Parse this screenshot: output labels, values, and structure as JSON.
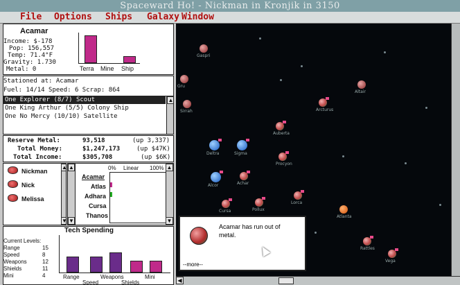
{
  "window": {
    "title": "Spaceward Ho! - Nickman in Kronjik in 3150"
  },
  "menu": [
    "File",
    "Options",
    "Ships",
    "Galaxy",
    "Window"
  ],
  "planet_panel": {
    "name": "Acamar",
    "income": "Income: $-178",
    "pop": "Pop: 156,557",
    "temp": "Temp: 71.4°F",
    "gravity": "Gravity: 1.730",
    "metal": "Metal: 0",
    "bars": [
      {
        "label": "Terra",
        "value": 0.85
      },
      {
        "label": "Mine",
        "value": 0.0
      },
      {
        "label": "Ship",
        "value": 0.22
      }
    ],
    "bar_label_terra": "Terra",
    "bar_label_mine": "Mine",
    "bar_label_ship": "Ship"
  },
  "fleet_panel": {
    "stationed": "Stationed at: Acamar",
    "fuel_speed_scrap": "Fuel: 14/14   Speed: 6    Scrap: 864",
    "ships": [
      "One Explorer (8/7) Scout",
      "One King Arthur (5/5) Colony Ship",
      "One No Mercy (10/10) Satellite"
    ]
  },
  "money_panel": {
    "reserve_label": "Reserve Metal:",
    "reserve_value": "93,518",
    "reserve_change": "(up 3,337)",
    "money_label": "Total Money:",
    "money_value": "$1,247,173",
    "money_change": "(up $47K)",
    "income_label": "Total Income:",
    "income_value": "$305,708",
    "income_change": "(up $6K)"
  },
  "players": [
    "Nickman",
    "Nick",
    "Melissa"
  ],
  "planet_list": {
    "header_pct0": "0%",
    "header_linear": "Linear",
    "header_pct100": "100%",
    "items": [
      "Acamar",
      "Atlas",
      "Adhara",
      "Cursa",
      "Thanos"
    ]
  },
  "tech_panel": {
    "title": "Tech Spending",
    "current_levels": "Current Levels:",
    "levels": [
      {
        "name": "Range",
        "value": "15"
      },
      {
        "name": "Speed",
        "value": "8"
      },
      {
        "name": "Weapons",
        "value": "12"
      },
      {
        "name": "Shields",
        "value": "11"
      },
      {
        "name": "Mini",
        "value": "4"
      }
    ],
    "bar_labels": [
      "Range",
      "Speed",
      "Weapons",
      "Shields",
      "Mini"
    ],
    "bars": [
      0.6,
      0.6,
      0.75,
      0.45,
      0.45
    ]
  },
  "map": {
    "planets": [
      {
        "name": "Gaspri",
        "kind": "red"
      },
      {
        "name": "Gru",
        "kind": "red"
      },
      {
        "name": "Sirrah",
        "kind": "red"
      },
      {
        "name": "Altair",
        "kind": "red"
      },
      {
        "name": "Arcturus",
        "kind": "owned"
      },
      {
        "name": "Auberta",
        "kind": "owned"
      },
      {
        "name": "Deltra",
        "kind": "blue"
      },
      {
        "name": "Sigma",
        "kind": "blue"
      },
      {
        "name": "Alcor",
        "kind": "blue"
      },
      {
        "name": "Procyon",
        "kind": "owned"
      },
      {
        "name": "Achar",
        "kind": "owned"
      },
      {
        "name": "Cursa",
        "kind": "owned"
      },
      {
        "name": "Pollux",
        "kind": "owned"
      },
      {
        "name": "Lorca",
        "kind": "owned"
      },
      {
        "name": "Atlanta",
        "kind": "orange"
      },
      {
        "name": "Rattles",
        "kind": "owned"
      },
      {
        "name": "Vega",
        "kind": "owned"
      }
    ]
  },
  "message": {
    "text": "Acamar has run out of metal.",
    "more": "--more--"
  }
}
